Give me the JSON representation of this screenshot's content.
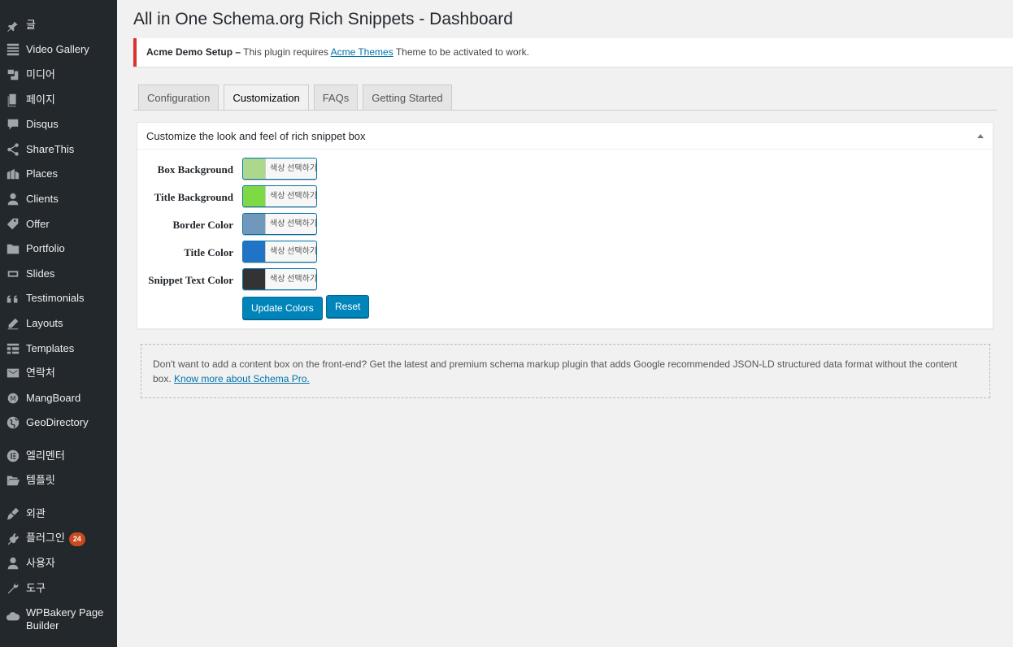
{
  "sidebar": {
    "items": [
      {
        "label": "글",
        "icon": "pin-icon"
      },
      {
        "label": "Video Gallery",
        "icon": "gallery-icon"
      },
      {
        "label": "미디어",
        "icon": "media-icon"
      },
      {
        "label": "페이지",
        "icon": "page-icon"
      },
      {
        "label": "Disqus",
        "icon": "comment-icon"
      },
      {
        "label": "ShareThis",
        "icon": "share-icon"
      },
      {
        "label": "Places",
        "icon": "places-icon"
      },
      {
        "label": "Clients",
        "icon": "user-icon"
      },
      {
        "label": "Offer",
        "icon": "tag-icon"
      },
      {
        "label": "Portfolio",
        "icon": "folder-icon"
      },
      {
        "label": "Slides",
        "icon": "slides-icon"
      },
      {
        "label": "Testimonials",
        "icon": "quote-icon"
      },
      {
        "label": "Layouts",
        "icon": "pencil-icon"
      },
      {
        "label": "Templates",
        "icon": "table-icon"
      },
      {
        "label": "연락처",
        "icon": "mail-icon"
      },
      {
        "label": "MangBoard",
        "icon": "mangboard-icon"
      },
      {
        "label": "GeoDirectory",
        "icon": "globe-icon"
      },
      {
        "label": "엘리멘터",
        "icon": "elementor-icon"
      },
      {
        "label": "템플릿",
        "icon": "folder-open-icon"
      },
      {
        "label": "외관",
        "icon": "brush-icon"
      },
      {
        "label": "플러그인",
        "icon": "plugin-icon",
        "badge": "24"
      },
      {
        "label": "사용자",
        "icon": "users-icon"
      },
      {
        "label": "도구",
        "icon": "wrench-icon"
      },
      {
        "label": "WPBakery Page Builder",
        "icon": "cloud-icon"
      }
    ]
  },
  "header": {
    "title": "All in One Schema.org Rich Snippets - Dashboard"
  },
  "notice": {
    "strong": "Acme Demo Setup –",
    "text_before": " This plugin requires ",
    "link": "Acme Themes",
    "text_after": " Theme to be activated to work."
  },
  "tabs": [
    "Configuration",
    "Customization",
    "FAQs",
    "Getting Started"
  ],
  "active_tab": "Customization",
  "panel": {
    "title": "Customize the look and feel of rich snippet box",
    "color_button_text": "색상 선택하기",
    "rows": [
      {
        "label": "Box Background",
        "color": "#acd88b"
      },
      {
        "label": "Title Background",
        "color": "#7fd945"
      },
      {
        "label": "Border Color",
        "color": "#7098bd"
      },
      {
        "label": "Title Color",
        "color": "#2073c5"
      },
      {
        "label": "Snippet Text Color",
        "color": "#333333"
      }
    ],
    "update_button": "Update Colors",
    "reset_button": "Reset"
  },
  "promo": {
    "text": "Don't want to add a content box on the front-end? Get the latest and premium schema markup plugin that adds Google recommended JSON-LD structured data format without the content box. ",
    "link": "Know more about Schema Pro."
  }
}
